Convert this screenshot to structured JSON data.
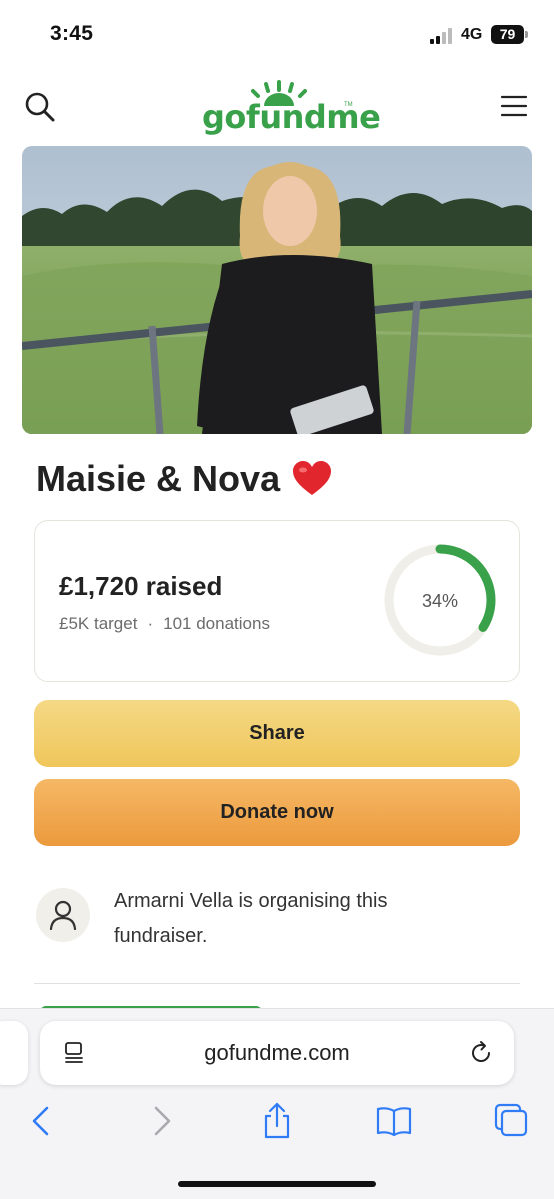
{
  "status_bar": {
    "time": "3:45",
    "network": "4G",
    "battery": "79"
  },
  "header": {
    "logo_text": "gofundme",
    "logo_trademark": "TM"
  },
  "campaign": {
    "title": "Maisie & Nova",
    "raised": "£1,720 raised",
    "target": "£5K target",
    "separator": "·",
    "donations": "101 donations",
    "progress_label": "34%",
    "progress_fraction": 0.34
  },
  "buttons": {
    "share": "Share",
    "donate": "Donate now"
  },
  "organiser": {
    "text": "Armarni Vella is organising this fundraiser."
  },
  "browser": {
    "url": "gofundme.com"
  },
  "colors": {
    "brand_green": "#3aa14b",
    "share_yellow": "#f0c65b",
    "donate_orange": "#ec9a3d",
    "ios_blue": "#2f7cf6"
  },
  "icons": [
    "search-icon",
    "menu-icon",
    "heart-icon",
    "user-icon",
    "reader-icon",
    "reload-icon",
    "back-icon",
    "forward-icon",
    "share-sheet-icon",
    "bookmarks-icon",
    "tabs-icon"
  ]
}
